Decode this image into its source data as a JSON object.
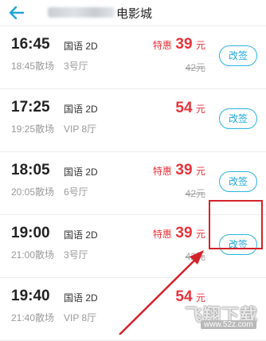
{
  "header": {
    "title_suffix": "电影城",
    "back_icon": "arrow-left-icon"
  },
  "colors": {
    "accent": "#1fa6d8",
    "price_red": "#e8333a",
    "highlight": "#d4222b"
  },
  "showtimes": [
    {
      "start": "16:45",
      "end": "18:45散场",
      "lang": "国语 2D",
      "hall": "3号厅",
      "promo": "特惠",
      "price": "39",
      "unit": "元",
      "orig": "42元",
      "button": "改签"
    },
    {
      "start": "17:25",
      "end": "19:25散场",
      "lang": "国语 2D",
      "hall": "VIP 8厅",
      "promo": "",
      "price": "54",
      "unit": "元",
      "orig": "",
      "button": "改签"
    },
    {
      "start": "18:05",
      "end": "20:05散场",
      "lang": "国语 2D",
      "hall": "6号厅",
      "promo": "特惠",
      "price": "39",
      "unit": "元",
      "orig": "42元",
      "button": "改签"
    },
    {
      "start": "19:00",
      "end": "21:00散场",
      "lang": "国语 2D",
      "hall": "3号厅",
      "promo": "特惠",
      "price": "39",
      "unit": "元",
      "orig": "42元",
      "button": "改签"
    },
    {
      "start": "19:40",
      "end": "21:40散场",
      "lang": "国语 2D",
      "hall": "VIP 8厅",
      "promo": "",
      "price": "54",
      "unit": "元",
      "orig": "",
      "button": "改签"
    }
  ],
  "watermark": {
    "main": "飞翔下载",
    "url": "www.52z.com"
  }
}
